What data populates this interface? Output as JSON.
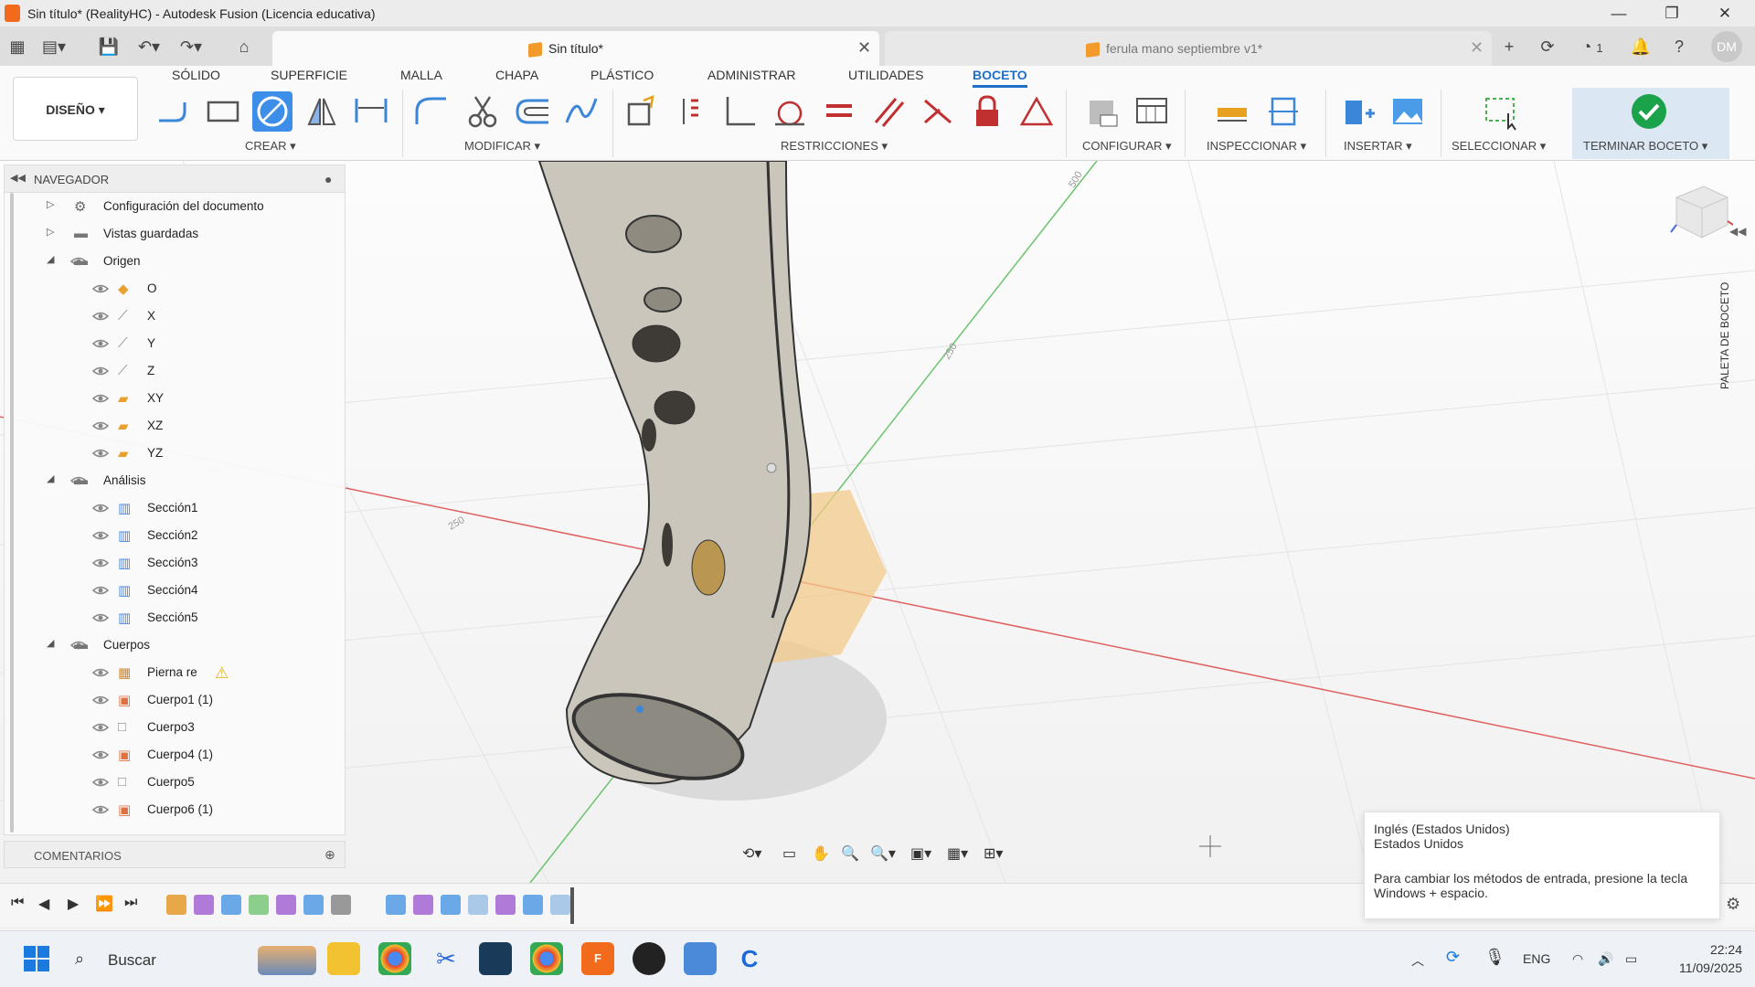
{
  "window": {
    "title": "Sin título* (RealityHC) - Autodesk Fusion (Licencia educativa)",
    "controls": [
      "—",
      "❐",
      "✕"
    ]
  },
  "tabs": [
    {
      "label": "Sin título*",
      "active": true
    },
    {
      "label": "ferula mano septiembre v1*",
      "active": false
    }
  ],
  "quick_access": {
    "job_count": "1",
    "user_initials": "DM"
  },
  "toolbar": {
    "design_menu": "DISEÑO ▾",
    "workspace_tabs": [
      "SÓLIDO",
      "SUPERFICIE",
      "MALLA",
      "CHAPA",
      "PLÁSTICO",
      "ADMINISTRAR",
      "UTILIDADES",
      "BOCETO"
    ],
    "active_tab": "BOCETO",
    "groups": {
      "create": "CREAR ▾",
      "modify": "MODIFICAR ▾",
      "constraints": "RESTRICCIONES ▾",
      "configure": "CONFIGURAR ▾",
      "inspect": "INSPECCIONAR ▾",
      "insert": "INSERTAR ▾",
      "select": "SELECCIONAR ▾",
      "finish": "TERMINAR BOCETO ▾"
    }
  },
  "browser": {
    "title": "NAVEGADOR",
    "items": [
      {
        "label": "Configuración del documento",
        "level": 0,
        "arrow": "▷",
        "icon": "gear-icon",
        "eye": false
      },
      {
        "label": "Vistas guardadas",
        "level": 0,
        "arrow": "▷",
        "icon": "folder-icon",
        "eye": false
      },
      {
        "label": "Origen",
        "level": 0,
        "arrow": "◢",
        "icon": "folder-icon",
        "eye": true
      },
      {
        "label": "O",
        "level": 1,
        "icon": "origin-point-icon",
        "eye": true
      },
      {
        "label": "X",
        "level": 1,
        "icon": "axis-icon",
        "eye": true
      },
      {
        "label": "Y",
        "level": 1,
        "icon": "axis-icon",
        "eye": true
      },
      {
        "label": "Z",
        "level": 1,
        "icon": "axis-icon",
        "eye": true
      },
      {
        "label": "XY",
        "level": 1,
        "icon": "plane-icon",
        "eye": true
      },
      {
        "label": "XZ",
        "level": 1,
        "icon": "plane-icon",
        "eye": true
      },
      {
        "label": "YZ",
        "level": 1,
        "icon": "plane-icon",
        "eye": true
      },
      {
        "label": "Análisis",
        "level": 0,
        "arrow": "◢",
        "icon": "folder-icon",
        "eye": true
      },
      {
        "label": "Sección1",
        "level": 1,
        "icon": "section-analysis-icon",
        "eye": true
      },
      {
        "label": "Sección2",
        "level": 1,
        "icon": "section-analysis-icon",
        "eye": true
      },
      {
        "label": "Sección3",
        "level": 1,
        "icon": "section-analysis-icon",
        "eye": true
      },
      {
        "label": "Sección4",
        "level": 1,
        "icon": "section-analysis-icon",
        "eye": true
      },
      {
        "label": "Sección5",
        "level": 1,
        "icon": "section-analysis-icon",
        "eye": true
      },
      {
        "label": "Cuerpos",
        "level": 0,
        "arrow": "◢",
        "icon": "folder-icon",
        "eye": true
      },
      {
        "label": "Pierna re",
        "level": 1,
        "icon": "mesh-body-icon",
        "eye": true,
        "warning": true
      },
      {
        "label": "Cuerpo1 (1)",
        "level": 1,
        "icon": "body-icon",
        "eye": true
      },
      {
        "label": "Cuerpo3",
        "level": 1,
        "icon": "body-outline-icon",
        "eye": true
      },
      {
        "label": "Cuerpo4 (1)",
        "level": 1,
        "icon": "body-icon",
        "eye": true
      },
      {
        "label": "Cuerpo5",
        "level": 1,
        "icon": "body-outline-icon",
        "eye": true
      },
      {
        "label": "Cuerpo6 (1)",
        "level": 1,
        "icon": "body-icon",
        "eye": true
      }
    ]
  },
  "comments": {
    "title": "COMENTARIOS"
  },
  "viewport": {
    "grid_labels": [
      "500",
      "250",
      "500",
      "250"
    ],
    "side_palette": "PALETA DE BOCETO"
  },
  "ime_tooltip": {
    "line1": "Inglés (Estados Unidos)",
    "line2": "Estados Unidos",
    "line3": "Para cambiar los métodos de entrada, presione la tecla",
    "line4": "Windows + espacio."
  },
  "taskbar": {
    "search_placeholder": "Buscar",
    "language": "ENG",
    "time": "22:24",
    "date": "11/09/2025"
  },
  "colors": {
    "accent": "#1f6fc9",
    "finish_check": "#1aa34a",
    "x_axis": "#e05050",
    "y_axis": "#4caf50"
  }
}
